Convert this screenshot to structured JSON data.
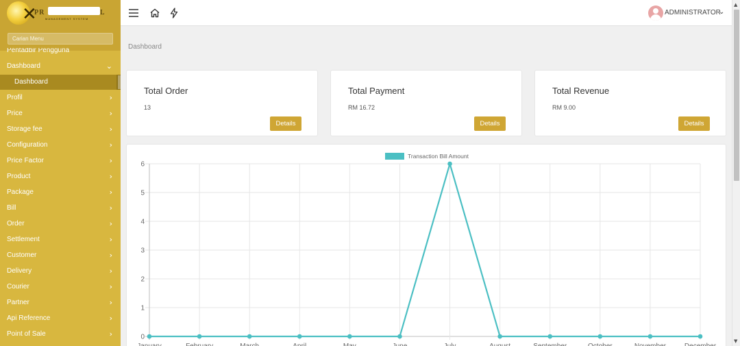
{
  "brand": {
    "name_start": "PR",
    "name_end": "L",
    "subtitle": "MANAGEMENT SYSTEM"
  },
  "sidebar": {
    "search_placeholder": "Carian Menu",
    "partial_item": "Pentadbir Pengguna",
    "items": [
      {
        "label": "Dashboard",
        "chevron": "⌄",
        "expanded": true
      },
      {
        "label": "Profil",
        "chevron": "›"
      },
      {
        "label": "Price",
        "chevron": "›"
      },
      {
        "label": "Storage fee",
        "chevron": "›"
      },
      {
        "label": "Configuration",
        "chevron": "›"
      },
      {
        "label": "Price Factor",
        "chevron": "›"
      },
      {
        "label": "Product",
        "chevron": "›"
      },
      {
        "label": "Package",
        "chevron": "›"
      },
      {
        "label": "Bill",
        "chevron": "›"
      },
      {
        "label": "Order",
        "chevron": "›"
      },
      {
        "label": "Settlement",
        "chevron": "›"
      },
      {
        "label": "Customer",
        "chevron": "›"
      },
      {
        "label": "Delivery",
        "chevron": "›"
      },
      {
        "label": "Courier",
        "chevron": "›"
      },
      {
        "label": "Partner",
        "chevron": "›"
      },
      {
        "label": "Api Reference",
        "chevron": "›"
      },
      {
        "label": "Point of Sale",
        "chevron": "›"
      }
    ],
    "active_submenu": "Dashboard"
  },
  "topbar": {
    "menu_icon": "hamburger-icon",
    "home_icon": "home-icon",
    "bolt_icon": "bolt-icon",
    "user_name": "ADMINISTRATOR",
    "user_chevron": "⌄"
  },
  "breadcrumb": "Dashboard",
  "cards": [
    {
      "title": "Total Order",
      "value": "13",
      "button": "Details"
    },
    {
      "title": "Total Payment",
      "value": "RM 16.72",
      "button": "Details"
    },
    {
      "title": "Total Revenue",
      "value": "RM 9.00",
      "button": "Details"
    }
  ],
  "colors": {
    "sidebar": "#d8b73f",
    "accent_button": "#cfa634",
    "series": "#4bbfc3"
  },
  "chart_data": {
    "type": "line",
    "categories": [
      "January",
      "February",
      "March",
      "April",
      "May",
      "June",
      "July",
      "August",
      "September",
      "October",
      "November",
      "December"
    ],
    "series": [
      {
        "name": "Transaction Bill Amount",
        "values": [
          0,
          0,
          0,
          0,
          0,
          0,
          6,
          0,
          0,
          0,
          0,
          0
        ]
      }
    ],
    "ylim": [
      0,
      6
    ],
    "yticks": [
      "0",
      "1",
      "2",
      "3",
      "4",
      "5",
      "6"
    ],
    "grid": true,
    "legend": "top-center"
  }
}
